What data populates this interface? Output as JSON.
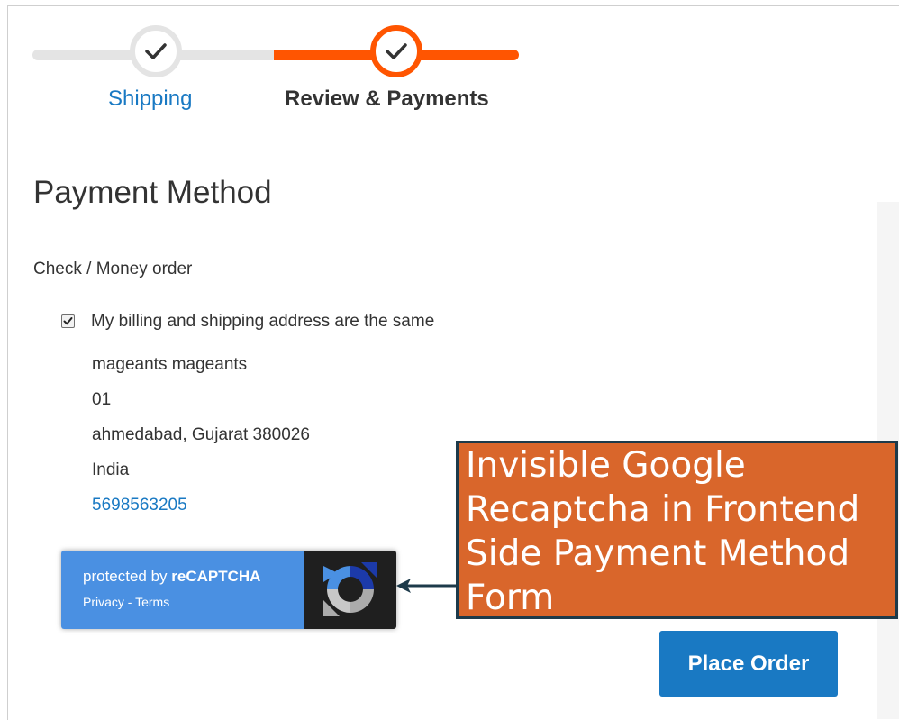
{
  "progress": {
    "steps": [
      {
        "label": "Shipping",
        "state": "complete"
      },
      {
        "label": "Review & Payments",
        "state": "active"
      }
    ],
    "accent_color": "#ff5501",
    "link_color": "#1979c3"
  },
  "payment": {
    "title": "Payment Method",
    "method_label": "Check / Money order",
    "same_address_label": "My billing and shipping address are the same",
    "same_address_checked": true,
    "address": {
      "name": "mageants mageants",
      "street": "01",
      "city_line": "ahmedabad, Gujarat 380026",
      "country": "India",
      "phone": "5698563205"
    }
  },
  "recaptcha": {
    "protected_prefix": "protected by ",
    "brand": "reCAPTCHA",
    "privacy": "Privacy",
    "separator": " - ",
    "terms": "Terms",
    "icon": "recaptcha-logo-icon"
  },
  "annotation": {
    "line1": "Invisible Google",
    "line2": "Recaptcha in Frontend",
    "line3": "Side Payment Method",
    "line4": "Form",
    "background_color": "#d9662b"
  },
  "actions": {
    "place_order_label": "Place Order",
    "button_color": "#1979c3"
  }
}
